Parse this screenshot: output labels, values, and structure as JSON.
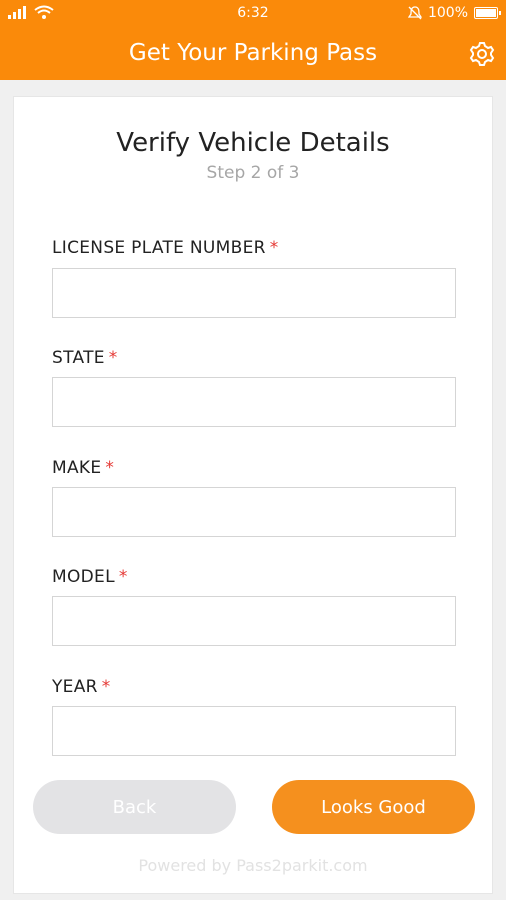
{
  "status_bar": {
    "time": "6:32",
    "battery": "100%",
    "icons": [
      "signal-icon",
      "wifi-icon",
      "alarm-icon",
      "battery-icon"
    ]
  },
  "app_bar": {
    "title": "Get Your Parking Pass",
    "settings_icon": "gear-icon"
  },
  "page": {
    "heading": "Verify Vehicle Details",
    "step": "Step 2 of 3"
  },
  "form": {
    "required_mark": "*",
    "fields": [
      {
        "label": "LICENSE PLATE NUMBER",
        "value": ""
      },
      {
        "label": "STATE",
        "value": ""
      },
      {
        "label": "MAKE",
        "value": ""
      },
      {
        "label": "MODEL",
        "value": ""
      },
      {
        "label": "YEAR",
        "value": ""
      }
    ]
  },
  "buttons": {
    "back": "Back",
    "next": "Looks Good"
  },
  "footer": "Powered by Pass2parkit.com",
  "colors": {
    "brand": "#fa8a0a",
    "primary_button": "#f5901e",
    "disabled_button": "#e3e3e5",
    "required": "#e53935"
  }
}
